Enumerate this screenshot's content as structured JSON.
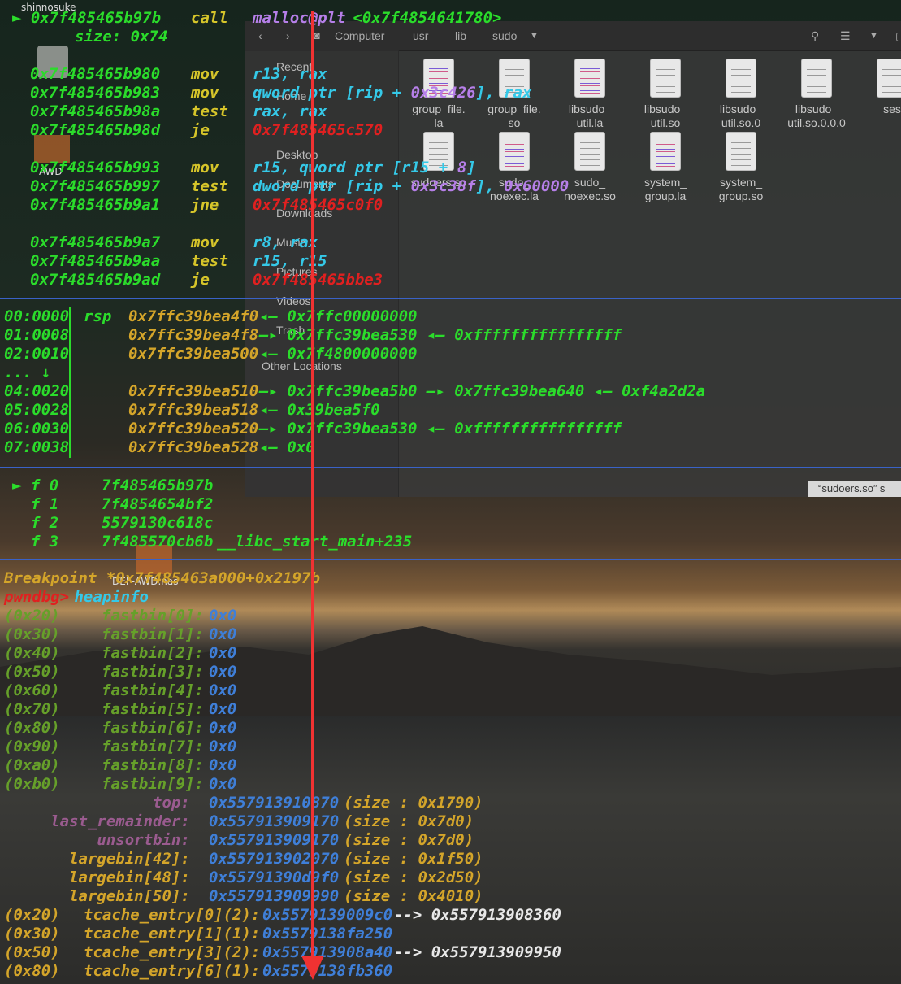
{
  "desktop": {
    "user": "shinnosuke",
    "icons": [
      "AWD",
      "DEF-AWD.nas"
    ]
  },
  "file_manager": {
    "nav": [
      "Computer",
      "usr",
      "lib",
      "sudo"
    ],
    "sidebar": [
      "Recent",
      "Home",
      "Desktop",
      "Documents",
      "Downloads",
      "Music",
      "Pictures",
      "Videos",
      "Trash",
      "Other Locations"
    ],
    "files_row1": [
      {
        "name": "group_file.\nla",
        "color": true
      },
      {
        "name": "group_file.\nso",
        "color": false
      },
      {
        "name": "libsudo_\nutil.la",
        "color": true
      },
      {
        "name": "libsudo_\nutil.so",
        "color": false
      },
      {
        "name": "libsudo_\nutil.so.0",
        "color": false
      },
      {
        "name": "libsudo_\nutil.so.0.0.0",
        "color": false
      },
      {
        "name": "ses",
        "color": false
      }
    ],
    "files_row2": [
      {
        "name": "sudoers.so",
        "color": false
      },
      {
        "name": "sudo_\nnoexec.la",
        "color": true
      },
      {
        "name": "sudo_\nnoexec.so",
        "color": false
      },
      {
        "name": "system_\ngroup.la",
        "color": true
      },
      {
        "name": "system_\ngroup.so",
        "color": false
      }
    ],
    "status": "“sudoers.so” s"
  },
  "disasm": [
    {
      "addr": "► 0x7f485465b97b",
      "op": "call",
      "args": "malloc@plt",
      "target": "<0x7f4854641780>"
    },
    {
      "sub": "size: 0x74"
    },
    {
      "addr": "0x7f485465b980",
      "op": "mov",
      "a1": "r13, rax"
    },
    {
      "addr": "0x7f485465b983",
      "op": "mov",
      "a1": "qword ptr [rip + ",
      "n1": "0x3c426",
      "a2": "], rax"
    },
    {
      "addr": "0x7f485465b98a",
      "op": "test",
      "a1": "rax, rax"
    },
    {
      "addr": "0x7f485465b98d",
      "op": "je",
      "red": "0x7f485465c570"
    },
    {
      "addr": "0x7f485465b993",
      "op": "mov",
      "a1": "r15, qword ptr [r15 + ",
      "n1": "8",
      "a2": "]"
    },
    {
      "addr": "0x7f485465b997",
      "op": "test",
      "a1": "dword ptr [rip + ",
      "n1": "0x3c38f",
      "a2": "], ",
      "n2": "0x60000"
    },
    {
      "addr": "0x7f485465b9a1",
      "op": "jne",
      "red": "0x7f485465c0f0"
    },
    {
      "addr": "0x7f485465b9a7",
      "op": "mov",
      "a1": "r8, rax"
    },
    {
      "addr": "0x7f485465b9aa",
      "op": "test",
      "a1": "r15, r15"
    },
    {
      "addr": "0x7f485465b9ad",
      "op": "je",
      "red": "0x7f485465bbe3"
    }
  ],
  "stack": [
    {
      "idx": "00:0000",
      "reg": "rsp",
      "addr": "0x7ffc39bea4f0",
      "rest": "◂— 0x7ffc00000000"
    },
    {
      "idx": "01:0008",
      "reg": "",
      "addr": "0x7ffc39bea4f8",
      "rest": "—▸ 0x7ffc39bea530 ◂— 0xffffffffffffffff"
    },
    {
      "idx": "02:0010",
      "reg": "",
      "addr": "0x7ffc39bea500",
      "rest": "◂— 0x7f4800000000"
    },
    {
      "idx": "... ↓",
      "reg": "",
      "addr": "",
      "rest": ""
    },
    {
      "idx": "04:0020",
      "reg": "",
      "addr": "0x7ffc39bea510",
      "rest": "—▸ 0x7ffc39bea5b0 —▸ 0x7ffc39bea640 ◂— 0xf4a2d2a"
    },
    {
      "idx": "05:0028",
      "reg": "",
      "addr": "0x7ffc39bea518",
      "rest": "◂— 0x39bea5f0"
    },
    {
      "idx": "06:0030",
      "reg": "",
      "addr": "0x7ffc39bea520",
      "rest": "—▸ 0x7ffc39bea530 ◂— 0xffffffffffffffff"
    },
    {
      "idx": "07:0038",
      "reg": "",
      "addr": "0x7ffc39bea528",
      "rest": "◂— 0x0"
    }
  ],
  "backtrace": [
    {
      "frame": "► f 0",
      "addr": "7f485465b97b",
      "sym": ""
    },
    {
      "frame": "  f 1",
      "addr": "7f4854654bf2",
      "sym": ""
    },
    {
      "frame": "  f 2",
      "addr": "5579130c618c",
      "sym": ""
    },
    {
      "frame": "  f 3",
      "addr": "7f485570cb6b",
      "sym": "__libc_start_main+235"
    }
  ],
  "breakpoint": "Breakpoint *0x7f485463a000+0x2197b",
  "prompt": "pwndbg>",
  "command": "heapinfo",
  "fastbins": [
    {
      "size": "(0x20)",
      "name": "fastbin[0]:",
      "val": "0x0"
    },
    {
      "size": "(0x30)",
      "name": "fastbin[1]:",
      "val": "0x0"
    },
    {
      "size": "(0x40)",
      "name": "fastbin[2]:",
      "val": "0x0"
    },
    {
      "size": "(0x50)",
      "name": "fastbin[3]:",
      "val": "0x0"
    },
    {
      "size": "(0x60)",
      "name": "fastbin[4]:",
      "val": "0x0"
    },
    {
      "size": "(0x70)",
      "name": "fastbin[5]:",
      "val": "0x0"
    },
    {
      "size": "(0x80)",
      "name": "fastbin[6]:",
      "val": "0x0"
    },
    {
      "size": "(0x90)",
      "name": "fastbin[7]:",
      "val": "0x0"
    },
    {
      "size": "(0xa0)",
      "name": "fastbin[8]:",
      "val": "0x0"
    },
    {
      "size": "(0xb0)",
      "name": "fastbin[9]:",
      "val": "0x0"
    }
  ],
  "bins": [
    {
      "name": "                top:",
      "addr": "0x557913910870",
      "info": "(size : 0x1790)",
      "cls": "m"
    },
    {
      "name": "     last_remainder:",
      "addr": "0x557913909170",
      "info": "(size : 0x7d0)",
      "cls": "m"
    },
    {
      "name": "          unsortbin:",
      "addr": "0x557913909170",
      "info": "(size : 0x7d0)",
      "cls": "m"
    },
    {
      "name": "       largebin[42]:",
      "addr": "0x557913902070",
      "info": "(size : 0x1f50)",
      "cls": "o"
    },
    {
      "name": "       largebin[48]:",
      "addr": "0x55791390d9f0",
      "info": "(size : 0x2d50)",
      "cls": "o"
    },
    {
      "name": "       largebin[50]:",
      "addr": "0x557913909990",
      "info": "(size : 0x4010)",
      "cls": "o"
    }
  ],
  "tcache": [
    {
      "size": "(0x20)",
      "name": "tcache_entry[0](2):",
      "addr": "0x5579139009c0",
      "next": "--> 0x557913908360"
    },
    {
      "size": "(0x30)",
      "name": "tcache_entry[1](1):",
      "addr": "0x5579138fa250",
      "next": ""
    },
    {
      "size": "(0x50)",
      "name": "tcache_entry[3](2):",
      "addr": "0x557913908a40",
      "next": "--> 0x557913909950"
    },
    {
      "size": "(0x80)",
      "name": "tcache_entry[6](1):",
      "addr": "0x5579138fb360",
      "next": ""
    }
  ]
}
